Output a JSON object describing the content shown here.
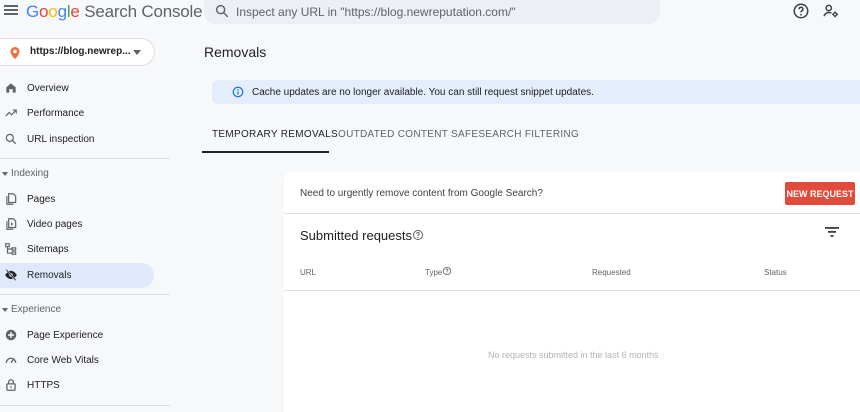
{
  "app": {
    "brand_google": "Google",
    "brand_product": "Search Console"
  },
  "search": {
    "placeholder": "Inspect any URL in \"https://blog.newreputation.com/\""
  },
  "property": {
    "label": "https://blog.newrep..."
  },
  "nav": {
    "overview": "Overview",
    "performance": "Performance",
    "url_inspection": "URL inspection",
    "indexing_section": "Indexing",
    "pages": "Pages",
    "video_pages": "Video pages",
    "sitemaps": "Sitemaps",
    "removals": "Removals",
    "experience_section": "Experience",
    "page_experience": "Page Experience",
    "core_web_vitals": "Core Web Vitals",
    "https": "HTTPS"
  },
  "main": {
    "title": "Removals",
    "banner": "Cache updates are no longer available. You can still request snippet updates.",
    "tabs": [
      "TEMPORARY REMOVALS",
      "OUTDATED CONTENT",
      "SAFESEARCH FILTERING"
    ],
    "urgent_text": "Need to urgently remove content from Google Search?",
    "new_request": "NEW REQUEST",
    "submitted_title": "Submitted requests",
    "columns": [
      "URL",
      "Type",
      "Requested",
      "Status"
    ],
    "empty_text": "No requests submitted in the last 6 months"
  },
  "colors": {
    "accent_blue": "#1a73e8",
    "active_nav_bg": "#dfe9fb",
    "new_request_bg": "#e04b3b",
    "banner_bg": "#e3edfc"
  }
}
